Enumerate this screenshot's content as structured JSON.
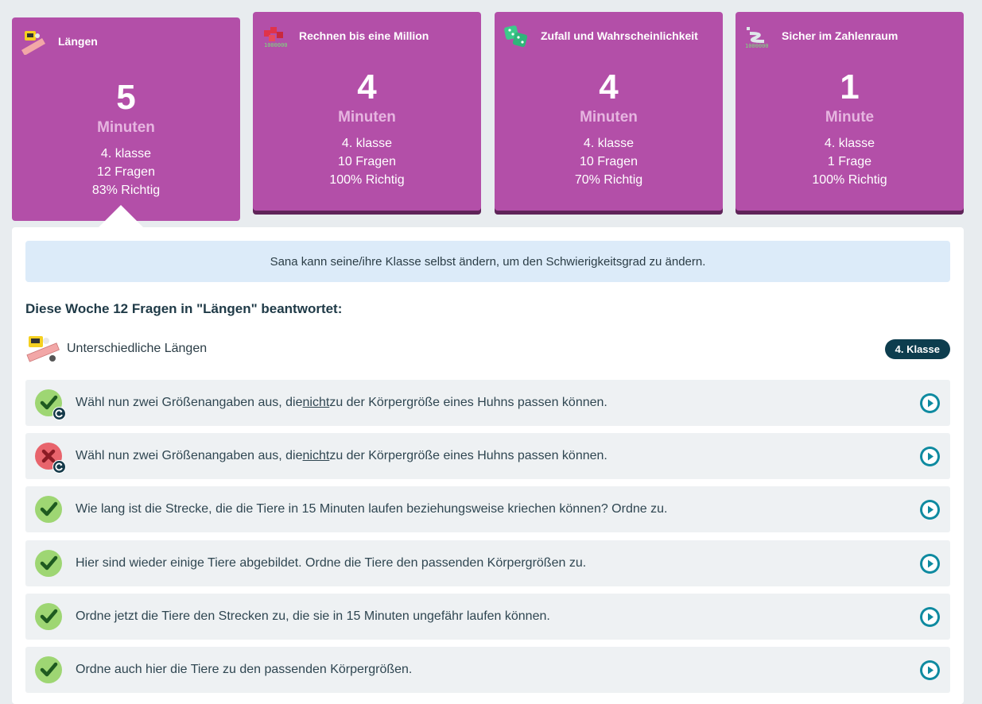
{
  "cards": [
    {
      "title": "Längen",
      "number": "5",
      "unit": "Minuten",
      "grade": "4. klasse",
      "questions": "12 Fragen",
      "correct": "83% Richtig",
      "icon": "ruler-icon"
    },
    {
      "title": "Rechnen bis eine Million",
      "number": "4",
      "unit": "Minuten",
      "grade": "4. klasse",
      "questions": "10 Fragen",
      "correct": "100% Richtig",
      "icon": "blocks-million-icon"
    },
    {
      "title": "Zufall und Wahrscheinlichkeit",
      "number": "4",
      "unit": "Minuten",
      "grade": "4. klasse",
      "questions": "10 Fragen",
      "correct": "70% Richtig",
      "icon": "dice-icon"
    },
    {
      "title": "Sicher im Zahlenraum",
      "number": "1",
      "unit": "Minute",
      "grade": "4. klasse",
      "questions": "1 Frage",
      "correct": "100% Richtig",
      "icon": "number-path-icon"
    }
  ],
  "info_text": "Sana kann seine/ihre Klasse selbst ändern, um den Schwierigkeitsgrad zu ändern.",
  "section_title": "Diese Woche 12 Fragen in \"Längen\" beantwortet:",
  "skill": {
    "label": "Unterschiedliche Längen",
    "badge": "4. Klasse",
    "icon": "ruler-skill-icon"
  },
  "questions": [
    {
      "status": "correct-retry",
      "pre": "Wähl nun zwei Größenangaben aus, die ",
      "underlined": "nicht",
      "post": " zu der Körpergröße eines Huhns passen können."
    },
    {
      "status": "wrong-retry",
      "pre": "Wähl nun zwei Größenangaben aus, die ",
      "underlined": "nicht",
      "post": " zu der Körpergröße eines Huhns passen können."
    },
    {
      "status": "correct",
      "pre": "Wie lang ist die Strecke, die die Tiere in 15 Minuten laufen beziehungsweise kriechen können? Ordne zu.",
      "underlined": "",
      "post": ""
    },
    {
      "status": "correct",
      "pre": "Hier sind wieder einige Tiere abgebildet. Ordne die Tiere den passenden Körpergrößen zu.",
      "underlined": "",
      "post": ""
    },
    {
      "status": "correct",
      "pre": "Ordne jetzt die Tiere den Strecken zu, die sie in 15 Minuten ungefähr laufen können.",
      "underlined": "",
      "post": ""
    },
    {
      "status": "correct",
      "pre": "Ordne auch hier die Tiere zu den passenden Körpergrößen.",
      "underlined": "",
      "post": ""
    }
  ],
  "colors": {
    "card": "#b34fa8",
    "badge": "#0d3d4e",
    "correct": "#9ed673",
    "wrong": "#e8646c",
    "play": "#0e8aa0"
  }
}
